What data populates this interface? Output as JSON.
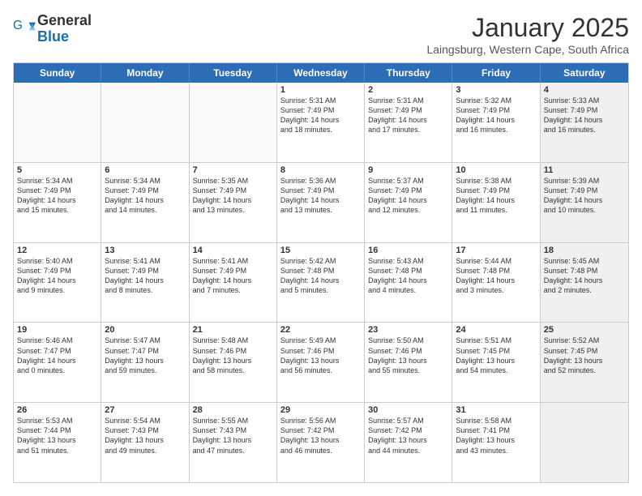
{
  "logo": {
    "general": "General",
    "blue": "Blue"
  },
  "header": {
    "title": "January 2025",
    "subtitle": "Laingsburg, Western Cape, South Africa"
  },
  "weekdays": [
    "Sunday",
    "Monday",
    "Tuesday",
    "Wednesday",
    "Thursday",
    "Friday",
    "Saturday"
  ],
  "rows": [
    [
      {
        "day": "",
        "text": "",
        "empty": true
      },
      {
        "day": "",
        "text": "",
        "empty": true
      },
      {
        "day": "",
        "text": "",
        "empty": true
      },
      {
        "day": "1",
        "text": "Sunrise: 5:31 AM\nSunset: 7:49 PM\nDaylight: 14 hours\nand 18 minutes."
      },
      {
        "day": "2",
        "text": "Sunrise: 5:31 AM\nSunset: 7:49 PM\nDaylight: 14 hours\nand 17 minutes."
      },
      {
        "day": "3",
        "text": "Sunrise: 5:32 AM\nSunset: 7:49 PM\nDaylight: 14 hours\nand 16 minutes."
      },
      {
        "day": "4",
        "text": "Sunrise: 5:33 AM\nSunset: 7:49 PM\nDaylight: 14 hours\nand 16 minutes.",
        "shaded": true
      }
    ],
    [
      {
        "day": "5",
        "text": "Sunrise: 5:34 AM\nSunset: 7:49 PM\nDaylight: 14 hours\nand 15 minutes."
      },
      {
        "day": "6",
        "text": "Sunrise: 5:34 AM\nSunset: 7:49 PM\nDaylight: 14 hours\nand 14 minutes."
      },
      {
        "day": "7",
        "text": "Sunrise: 5:35 AM\nSunset: 7:49 PM\nDaylight: 14 hours\nand 13 minutes."
      },
      {
        "day": "8",
        "text": "Sunrise: 5:36 AM\nSunset: 7:49 PM\nDaylight: 14 hours\nand 13 minutes."
      },
      {
        "day": "9",
        "text": "Sunrise: 5:37 AM\nSunset: 7:49 PM\nDaylight: 14 hours\nand 12 minutes."
      },
      {
        "day": "10",
        "text": "Sunrise: 5:38 AM\nSunset: 7:49 PM\nDaylight: 14 hours\nand 11 minutes."
      },
      {
        "day": "11",
        "text": "Sunrise: 5:39 AM\nSunset: 7:49 PM\nDaylight: 14 hours\nand 10 minutes.",
        "shaded": true
      }
    ],
    [
      {
        "day": "12",
        "text": "Sunrise: 5:40 AM\nSunset: 7:49 PM\nDaylight: 14 hours\nand 9 minutes."
      },
      {
        "day": "13",
        "text": "Sunrise: 5:41 AM\nSunset: 7:49 PM\nDaylight: 14 hours\nand 8 minutes."
      },
      {
        "day": "14",
        "text": "Sunrise: 5:41 AM\nSunset: 7:49 PM\nDaylight: 14 hours\nand 7 minutes."
      },
      {
        "day": "15",
        "text": "Sunrise: 5:42 AM\nSunset: 7:48 PM\nDaylight: 14 hours\nand 5 minutes."
      },
      {
        "day": "16",
        "text": "Sunrise: 5:43 AM\nSunset: 7:48 PM\nDaylight: 14 hours\nand 4 minutes."
      },
      {
        "day": "17",
        "text": "Sunrise: 5:44 AM\nSunset: 7:48 PM\nDaylight: 14 hours\nand 3 minutes."
      },
      {
        "day": "18",
        "text": "Sunrise: 5:45 AM\nSunset: 7:48 PM\nDaylight: 14 hours\nand 2 minutes.",
        "shaded": true
      }
    ],
    [
      {
        "day": "19",
        "text": "Sunrise: 5:46 AM\nSunset: 7:47 PM\nDaylight: 14 hours\nand 0 minutes."
      },
      {
        "day": "20",
        "text": "Sunrise: 5:47 AM\nSunset: 7:47 PM\nDaylight: 13 hours\nand 59 minutes."
      },
      {
        "day": "21",
        "text": "Sunrise: 5:48 AM\nSunset: 7:46 PM\nDaylight: 13 hours\nand 58 minutes."
      },
      {
        "day": "22",
        "text": "Sunrise: 5:49 AM\nSunset: 7:46 PM\nDaylight: 13 hours\nand 56 minutes."
      },
      {
        "day": "23",
        "text": "Sunrise: 5:50 AM\nSunset: 7:46 PM\nDaylight: 13 hours\nand 55 minutes."
      },
      {
        "day": "24",
        "text": "Sunrise: 5:51 AM\nSunset: 7:45 PM\nDaylight: 13 hours\nand 54 minutes."
      },
      {
        "day": "25",
        "text": "Sunrise: 5:52 AM\nSunset: 7:45 PM\nDaylight: 13 hours\nand 52 minutes.",
        "shaded": true
      }
    ],
    [
      {
        "day": "26",
        "text": "Sunrise: 5:53 AM\nSunset: 7:44 PM\nDaylight: 13 hours\nand 51 minutes."
      },
      {
        "day": "27",
        "text": "Sunrise: 5:54 AM\nSunset: 7:43 PM\nDaylight: 13 hours\nand 49 minutes."
      },
      {
        "day": "28",
        "text": "Sunrise: 5:55 AM\nSunset: 7:43 PM\nDaylight: 13 hours\nand 47 minutes."
      },
      {
        "day": "29",
        "text": "Sunrise: 5:56 AM\nSunset: 7:42 PM\nDaylight: 13 hours\nand 46 minutes."
      },
      {
        "day": "30",
        "text": "Sunrise: 5:57 AM\nSunset: 7:42 PM\nDaylight: 13 hours\nand 44 minutes."
      },
      {
        "day": "31",
        "text": "Sunrise: 5:58 AM\nSunset: 7:41 PM\nDaylight: 13 hours\nand 43 minutes."
      },
      {
        "day": "",
        "text": "",
        "empty": true,
        "shaded": true
      }
    ]
  ]
}
